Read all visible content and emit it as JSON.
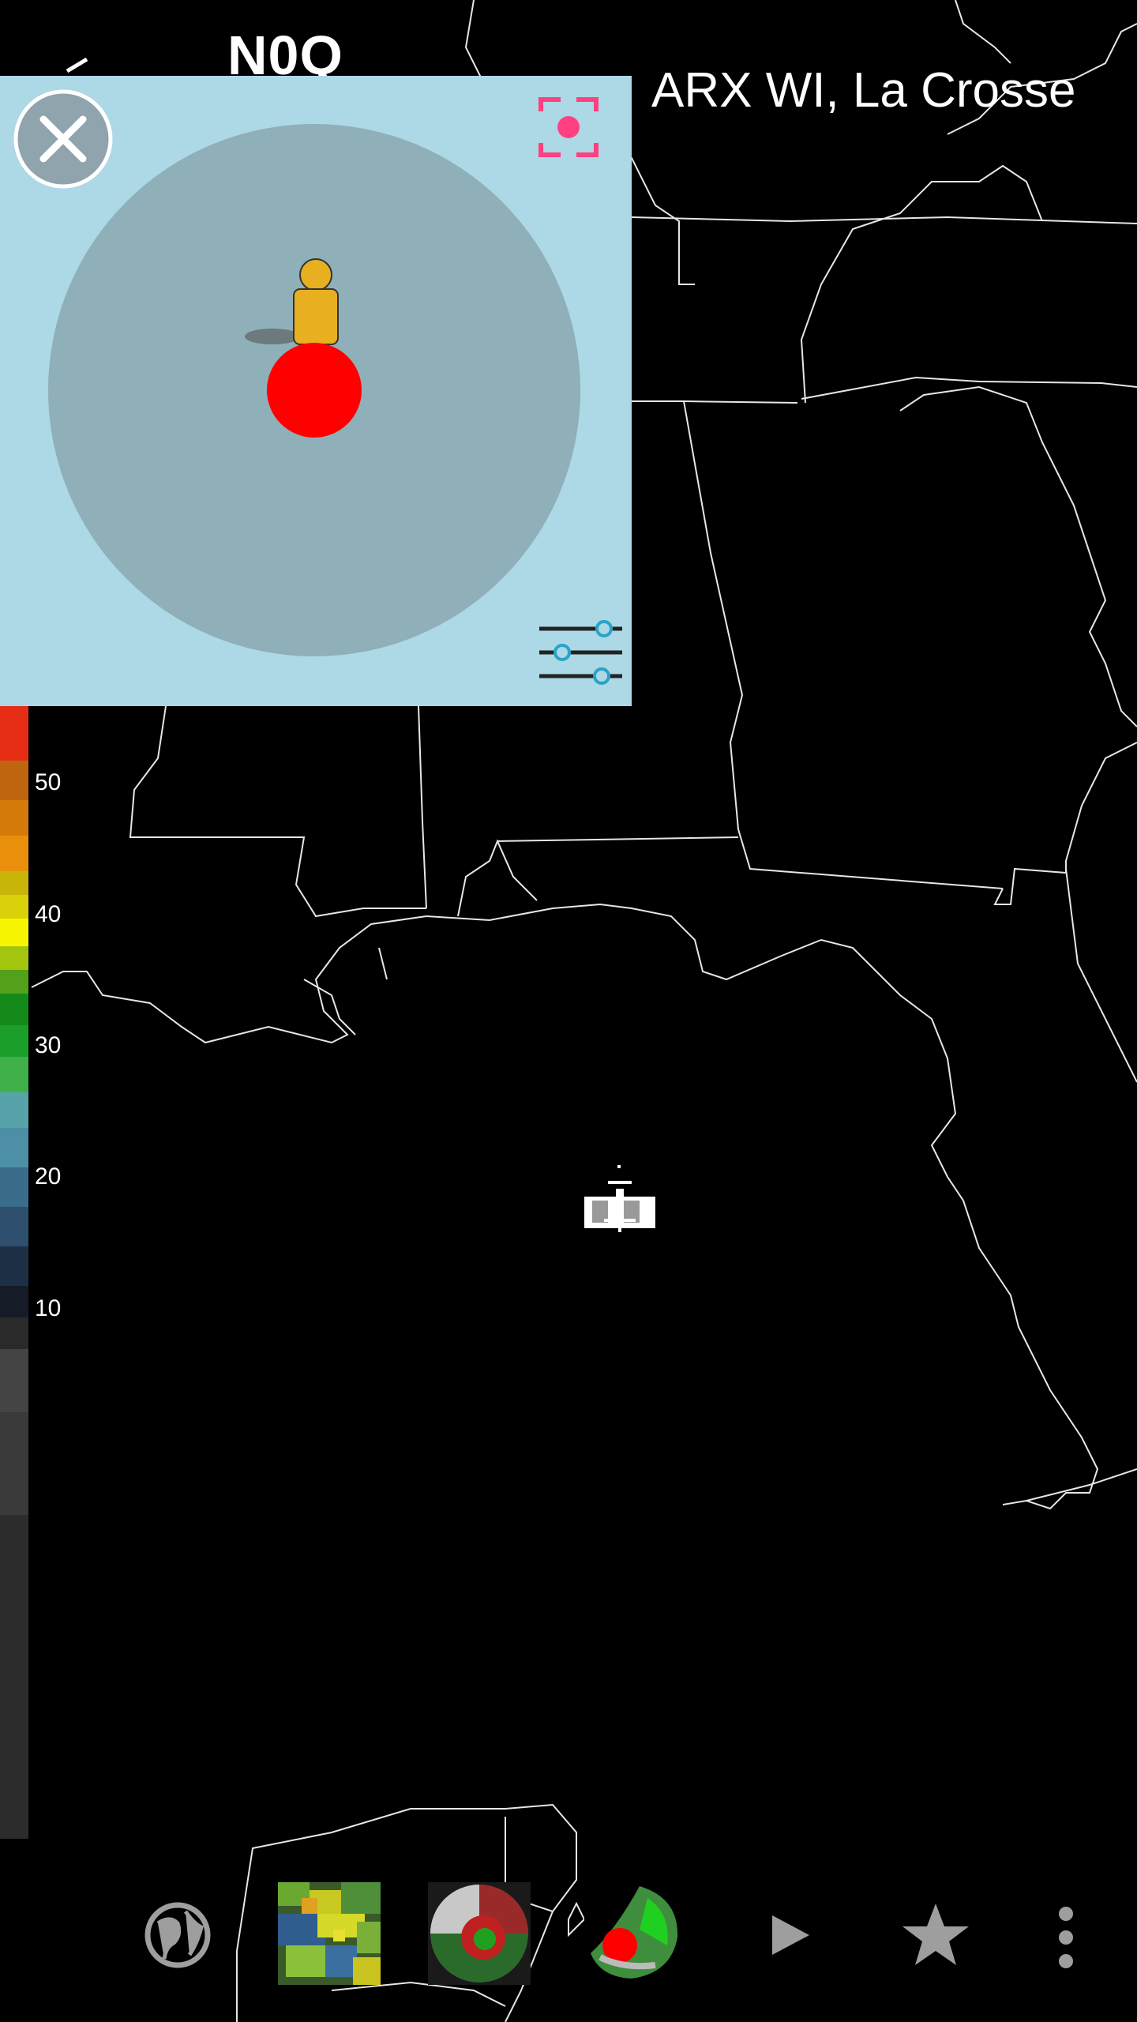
{
  "header": {
    "product_code": "N0Q",
    "station_title": "ARX WI, La Crosse"
  },
  "legend": {
    "labels": [
      "50",
      "40",
      "30",
      "20",
      "10"
    ]
  },
  "popup": {
    "close_icon": "close-icon",
    "recenter_icon": "recenter-icon",
    "settings_icon": "sliders-icon",
    "accent_color": "#ff4081",
    "location_marker_color": "#ff0000"
  },
  "toolbar": {
    "icons": [
      "globe-icon",
      "radar-thumbnail-reflectivity",
      "radar-thumbnail-velocity",
      "radar-thumbnail-storm",
      "play-icon",
      "star-icon",
      "more-vert-icon"
    ]
  }
}
